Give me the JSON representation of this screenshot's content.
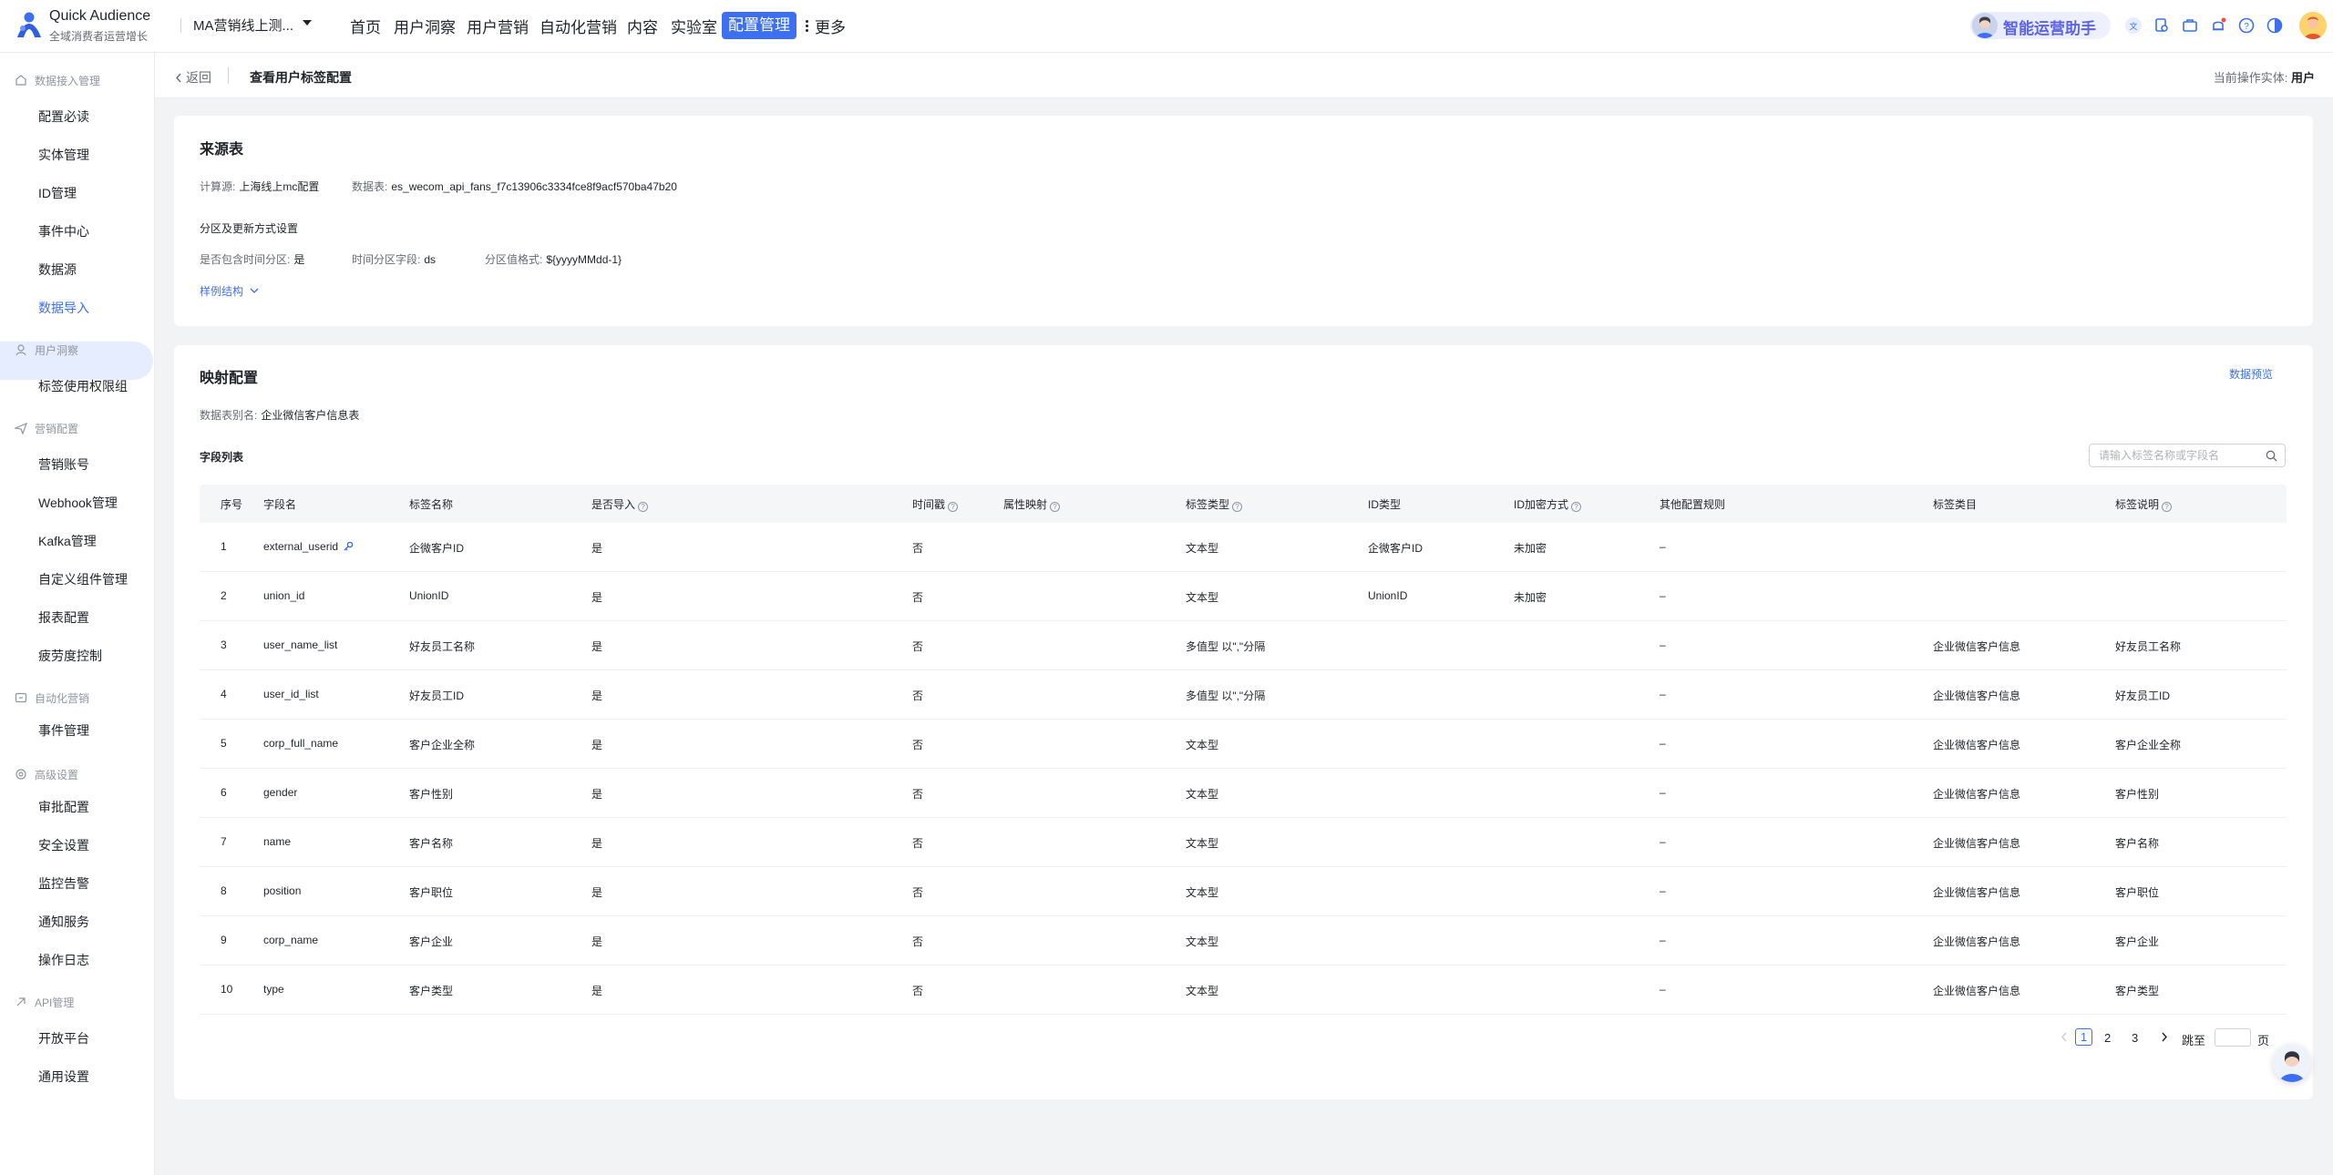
{
  "app": {
    "brand_title": "Quick Audience",
    "brand_subtitle": "全域消费者运营增长",
    "workspace": "MA营销线上测..."
  },
  "nav": {
    "items": [
      "首页",
      "用户洞察",
      "用户营销",
      "自动化营销",
      "内容",
      "实验室"
    ],
    "active": "配置管理",
    "more": "更多"
  },
  "assistant": {
    "label": "智能运营助手"
  },
  "sidebar": {
    "groups": [
      {
        "label": "数据接入管理",
        "items": [
          "配置必读",
          "实体管理",
          "ID管理",
          "事件中心",
          "数据源",
          "数据导入"
        ]
      },
      {
        "label": "用户洞察",
        "items": [
          "标签使用权限组"
        ]
      },
      {
        "label": "营销配置",
        "items": [
          "营销账号",
          "Webhook管理",
          "Kafka管理",
          "自定义组件管理",
          "报表配置",
          "疲劳度控制"
        ]
      },
      {
        "label": "自动化营销",
        "items": [
          "事件管理"
        ]
      },
      {
        "label": "高级设置",
        "items": [
          "审批配置",
          "安全设置",
          "监控告警",
          "通知服务",
          "操作日志"
        ]
      },
      {
        "label": "API管理",
        "items": [
          "开放平台",
          "通用设置"
        ]
      }
    ],
    "active_item": "数据导入"
  },
  "page": {
    "back": "返回",
    "title": "查看用户标签配置",
    "entity_label": "当前操作实体:",
    "entity_value": "用户"
  },
  "source": {
    "title": "来源表",
    "compute_label": "计算源:",
    "compute_value": "上海线上mc配置",
    "table_label": "数据表:",
    "table_value": "es_wecom_api_fans_f7c13906c3334fce8f9acf570ba47b20",
    "partition_title": "分区及更新方式设置",
    "has_time_partition_label": "是否包含时间分区:",
    "has_time_partition_value": "是",
    "time_field_label": "时间分区字段:",
    "time_field_value": "ds",
    "format_label": "分区值格式:",
    "format_value": "${yyyyMMdd-1}",
    "sample_link": "样例结构"
  },
  "mapping": {
    "title": "映射配置",
    "preview_link": "数据预览",
    "alias_label": "数据表别名:",
    "alias_value": "企业微信客户信息表",
    "field_list_title": "字段列表",
    "search_placeholder": "请输入标签名称或字段名"
  },
  "table": {
    "headers": [
      "序号",
      "字段名",
      "标签名称",
      "是否导入",
      "时间戳",
      "属性映射",
      "标签类型",
      "ID类型",
      "ID加密方式",
      "其他配置规则",
      "标签类目",
      "标签说明"
    ],
    "rows": [
      [
        "1",
        "external_userid",
        "企微客户ID",
        "是",
        "否",
        "",
        "文本型",
        "企微客户ID",
        "未加密",
        "–",
        "",
        ""
      ],
      [
        "2",
        "union_id",
        "UnionID",
        "是",
        "否",
        "",
        "文本型",
        "UnionID",
        "未加密",
        "–",
        "",
        ""
      ],
      [
        "3",
        "user_name_list",
        "好友员工名称",
        "是",
        "否",
        "",
        "多值型 以\",\"分隔",
        "",
        "",
        "–",
        "企业微信客户信息",
        "好友员工名称"
      ],
      [
        "4",
        "user_id_list",
        "好友员工ID",
        "是",
        "否",
        "",
        "多值型 以\",\"分隔",
        "",
        "",
        "–",
        "企业微信客户信息",
        "好友员工ID"
      ],
      [
        "5",
        "corp_full_name",
        "客户企业全称",
        "是",
        "否",
        "",
        "文本型",
        "",
        "",
        "–",
        "企业微信客户信息",
        "客户企业全称"
      ],
      [
        "6",
        "gender",
        "客户性别",
        "是",
        "否",
        "",
        "文本型",
        "",
        "",
        "–",
        "企业微信客户信息",
        "客户性别"
      ],
      [
        "7",
        "name",
        "客户名称",
        "是",
        "否",
        "",
        "文本型",
        "",
        "",
        "–",
        "企业微信客户信息",
        "客户名称"
      ],
      [
        "8",
        "position",
        "客户职位",
        "是",
        "否",
        "",
        "文本型",
        "",
        "",
        "–",
        "企业微信客户信息",
        "客户职位"
      ],
      [
        "9",
        "corp_name",
        "客户企业",
        "是",
        "否",
        "",
        "文本型",
        "",
        "",
        "–",
        "企业微信客户信息",
        "客户企业"
      ],
      [
        "10",
        "type",
        "客户类型",
        "是",
        "否",
        "",
        "文本型",
        "",
        "",
        "–",
        "企业微信客户信息",
        "客户类型"
      ]
    ]
  },
  "pagination": {
    "pages": [
      "1",
      "2",
      "3"
    ],
    "current": "1",
    "jump_label": "跳至",
    "page_suffix": "页"
  },
  "colors": {
    "accent": "#3d6ff2",
    "active_bg": "#e6edff"
  }
}
